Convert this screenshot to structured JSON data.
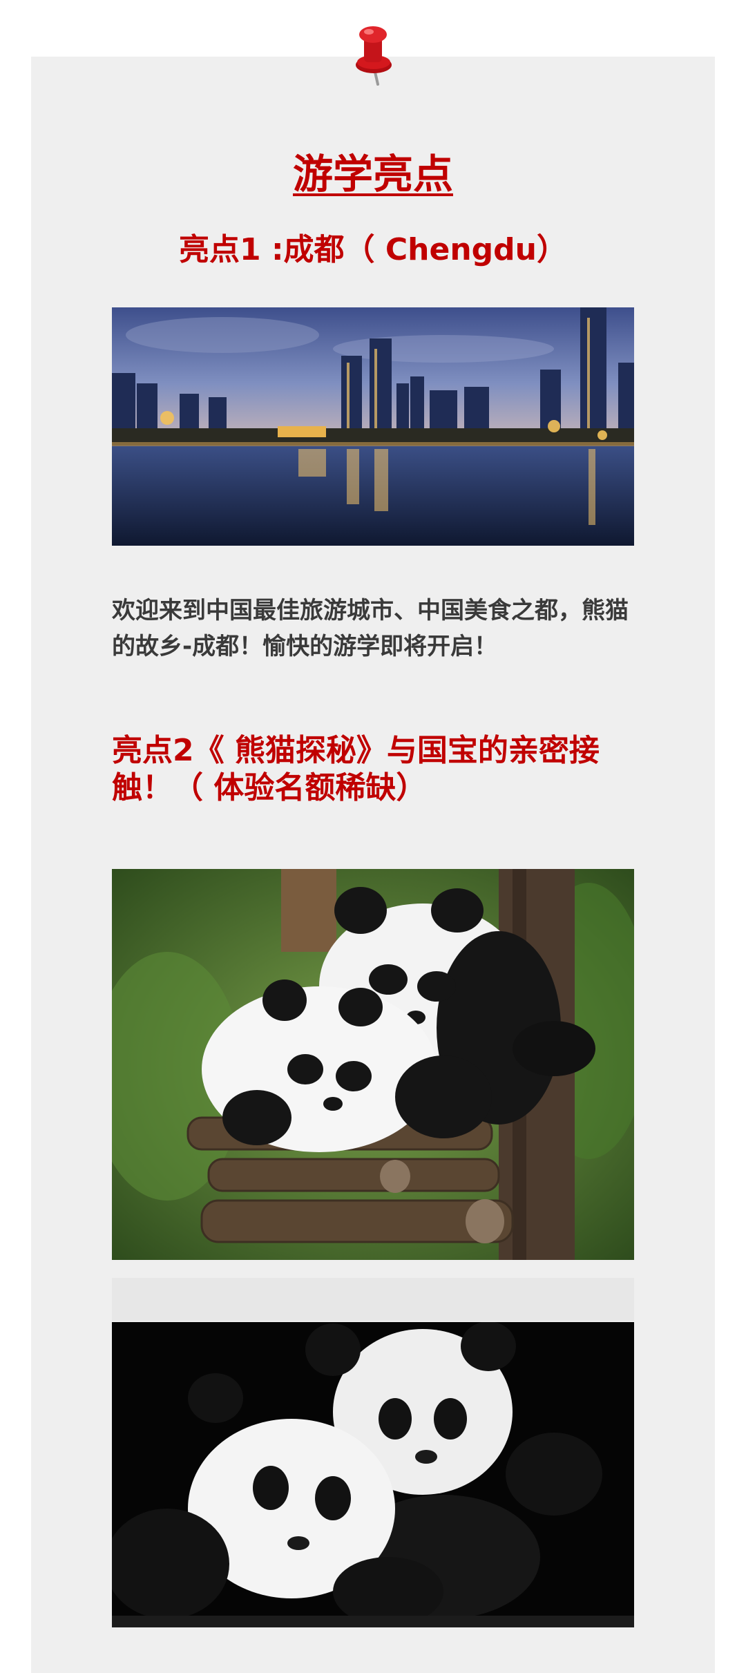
{
  "article": {
    "main_title": "游学亮点",
    "highlight1_title": "亮点1 :成都（ Chengdu）",
    "highlight1_text": "欢迎来到中国最佳旅游城市、中国美食之都，熊猫的故乡-成都！愉快的游学即将开启！",
    "highlight2_title": "亮点2《 熊猫探秘》与国宝的亲密接触！（ 体验名额稀缺）"
  },
  "icons": {
    "pin": "pushpin-icon"
  },
  "colors": {
    "accent": "#c00000",
    "card_bg": "#efefef",
    "body_text": "#3a3a3a"
  }
}
